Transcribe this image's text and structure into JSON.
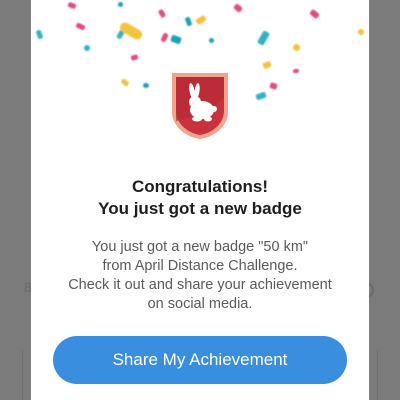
{
  "dialog": {
    "title_lines": [
      "Congratulations!",
      "You just got a new badge"
    ],
    "message_lines": [
      "You just got a new badge \"50 km\"",
      "from April Distance Challenge.",
      "Check it out and share your achievement",
      "on social media."
    ],
    "share_button_label": "Share My Achievement",
    "close_icon": "close-icon",
    "badge_icon": "rabbit-badge-icon"
  },
  "colors": {
    "overlay": "#7b7b7b",
    "dialog_background": "#ffffff",
    "button": "#3a8ee0",
    "badge_shield": "#c9323d",
    "badge_border": "#f2a48e",
    "confetti": [
      "#e8487a",
      "#1aa3b0",
      "#f5c33b",
      "#2fb3c4"
    ]
  }
}
